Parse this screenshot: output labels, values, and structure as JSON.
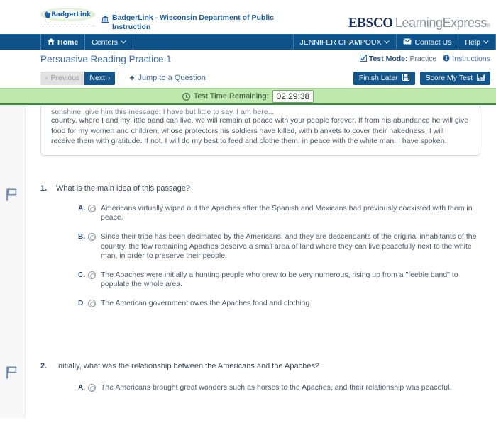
{
  "header": {
    "badgerlink_logo_text": "BadgerLink",
    "institution_icon": "bank-icon",
    "institution_name": "BadgerLink - Wisconsin Department of Public Instruction",
    "brand_primary": "EBSCO",
    "brand_secondary": "LearningExpress",
    "brand_registered": "®"
  },
  "navbar": {
    "home_label": "Home",
    "home_icon": "home-icon",
    "centers_label": "Centers",
    "centers_chevron": "⌄",
    "user_label": "JENNIFER CHAMPOUX",
    "user_chevron": "⌄",
    "contact_label": "Contact Us",
    "contact_icon": "envelope-icon",
    "help_label": "Help",
    "help_chevron": "⌄",
    "background_color": "#0d5289"
  },
  "title_row": {
    "page_title": "Persuasive Reading Practice 1",
    "test_mode_icon": "checkbox-checked-icon",
    "test_mode_label": "Test Mode:",
    "test_mode_value": "Practice",
    "instructions_icon": "info-icon",
    "instructions_label": "Instructions"
  },
  "toolbar": {
    "previous_label": "Previous",
    "previous_chevron": "‹",
    "previous_enabled": false,
    "next_label": "Next",
    "next_chevron": "›",
    "jump_plus": "+",
    "jump_label": "Jump to a Question",
    "finish_later_label": "Finish Later",
    "finish_later_icon": "save-floppy-icon",
    "score_test_label": "Score My Test",
    "score_test_icon": "bar-chart-icon",
    "button_color": "#14558c"
  },
  "timer": {
    "clock_icon": "clock-icon",
    "label": "Test Time Remaining:",
    "value": "02:29:38",
    "banner_color": "#bfe8ae",
    "border_color": "#3c8a40"
  },
  "passage": {
    "clipped_top_line": "sunshine, give him this message: I have but little to say. I am here...",
    "text": "country, where I and my little band can live, we will remain at peace with your people forever. If from his abundance he will give food for my women and children, whose protectors his soldiers have killed, with blankets to cover their nakedness, I will receive them with gratitude. If not, I will do my best to feed and clothe them, in peace with the white man. I have spoken."
  },
  "questions": [
    {
      "flag_icon": "flag-outline-icon",
      "number": "1.",
      "text": "What is the main idea of this passage?",
      "answers": [
        {
          "letter": "A.",
          "text": "Americans virtually wiped out the Apaches after the Spanish and Mexicans had previously coexisted with them in peace.",
          "selected": false
        },
        {
          "letter": "B.",
          "text": "Since their tribe has been decimated by the Americans, and they are descendants of the original inhabitants of the country, the few remaining Apaches deserve a small area of land where they can live peacefully next to the white man, in order to preserve their people.",
          "selected": false
        },
        {
          "letter": "C.",
          "text": "The Apaches were initially a hunting people who grew to be very numerous, rising up from a \"feeble band\" to populate the whole area.",
          "selected": false
        },
        {
          "letter": "D.",
          "text": "The American government owes the Apaches food and clothing.",
          "selected": false
        }
      ]
    },
    {
      "flag_icon": "flag-outline-icon",
      "number": "2.",
      "text": "Initially, what was the relationship between the Americans and the Apaches?",
      "answers": [
        {
          "letter": "A.",
          "text": "The Americans brought great wonders such as horses to the Apaches, and their relationship was peaceful.",
          "selected": false
        }
      ]
    }
  ]
}
